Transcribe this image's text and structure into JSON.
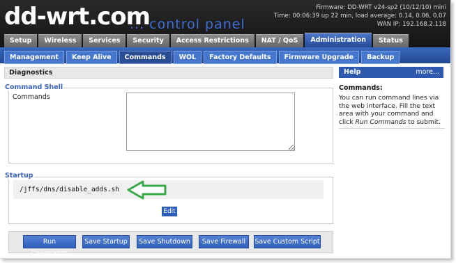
{
  "header": {
    "logo_text": "dd-wrt.com",
    "tagline": "... control panel",
    "firmware": "Firmware: DD-WRT v24-sp2 (10/12/10) mini",
    "time_load": "Time: 00:06:39 up 22 min, load average: 0.14, 0.06, 0.07",
    "wan_ip": "WAN IP: 192.168.2.118"
  },
  "main_tabs": [
    {
      "label": "Setup"
    },
    {
      "label": "Wireless"
    },
    {
      "label": "Services"
    },
    {
      "label": "Security"
    },
    {
      "label": "Access Restrictions"
    },
    {
      "label": "NAT / QoS"
    },
    {
      "label": "Administration"
    },
    {
      "label": "Status"
    }
  ],
  "sub_tabs": [
    {
      "label": "Management"
    },
    {
      "label": "Keep Alive"
    },
    {
      "label": "Commands"
    },
    {
      "label": "WOL"
    },
    {
      "label": "Factory Defaults"
    },
    {
      "label": "Firmware Upgrade"
    },
    {
      "label": "Backup"
    }
  ],
  "content": {
    "section_title": "Diagnostics",
    "command_shell_legend": "Command Shell",
    "commands_label": "Commands",
    "commands_value": "",
    "startup_legend": "Startup",
    "startup_script": "/jffs/dns/disable_adds.sh",
    "edit_label": "Edit"
  },
  "buttons": {
    "run_commands": "Run Commands",
    "save_startup": "Save Startup",
    "save_shutdown": "Save Shutdown",
    "save_firewall": "Save Firewall",
    "save_custom_script": "Save Custom Script"
  },
  "help": {
    "title": "Help",
    "more": "more...",
    "subtitle": "Commands:",
    "text_1": "You can run command lines via the web interface. Fill the text area with your command and click ",
    "text_run": "Run Commands",
    "text_2": " to submit."
  },
  "colors": {
    "accent_blue": "#2d58ae",
    "annotation_arrow": "#3aa84a",
    "header_bg": "#1b1b1b"
  },
  "icons": {
    "annotation": "right-arrow-outline",
    "textarea_grip": "resize-grip-icon"
  }
}
